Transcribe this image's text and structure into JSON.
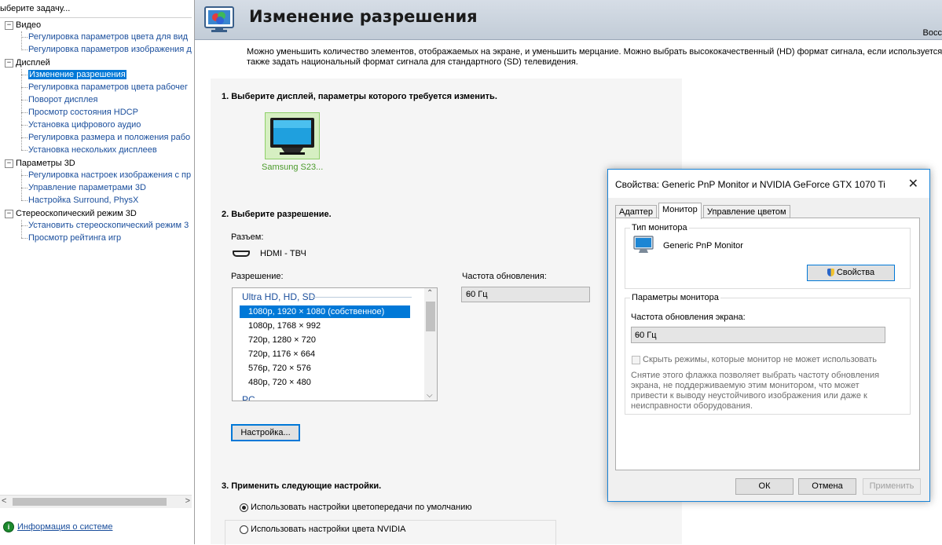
{
  "left_panel": {
    "title": "ыберите задачу...",
    "tree": [
      {
        "label": "Видео",
        "items": [
          "Регулировка параметров цвета для вид",
          "Регулировка параметров изображения д"
        ]
      },
      {
        "label": "Дисплей",
        "items": [
          "Изменение разрешения",
          "Регулировка параметров цвета рабочег",
          "Поворот дисплея",
          "Просмотр состояния HDCP",
          "Установка цифрового аудио",
          "Регулировка размера и положения рабо",
          "Установка нескольких дисплеев"
        ]
      },
      {
        "label": "Параметры 3D",
        "items": [
          "Регулировка настроек изображения с пр",
          "Управление параметрами 3D",
          "Настройка Surround, PhysX"
        ]
      },
      {
        "label": "Стереоскопический режим 3D",
        "items": [
          "Установить стереоскопический режим 3",
          "Просмотр рейтинга игр"
        ]
      }
    ],
    "selected_item": "Изменение разрешения",
    "system_info_link": "Информация о системе",
    "expander_symbol": "−"
  },
  "header": {
    "title": "Изменение разрешения",
    "restore_text": "Восс"
  },
  "description": {
    "line1": "Можно уменьшить количество элементов, отображаемых на экране, и уменьшить мерцание. Можно выбрать высококачественный (HD) формат сигнала, если используется",
    "line2": "также задать национальный формат сигнала для стандартного (SD) телевидения."
  },
  "section1": {
    "title": "1. Выберите дисплей, параметры которого требуется изменить.",
    "display_label": "Samsung S23..."
  },
  "section2": {
    "title": "2. Выберите разрешение.",
    "connector_label": "Разъем:",
    "connector_value": "HDMI - ТВЧ",
    "resolution_label": "Разрешение:",
    "refresh_label": "Частота обновления:",
    "refresh_value": "60 Гц",
    "list_group": "Ultra HD, HD, SD",
    "resolutions": [
      "1080p, 1920 × 1080 (собственное)",
      "1080p, 1768 × 992",
      "720p, 1280 × 720",
      "720p, 1176 × 664",
      "576p, 720 × 576",
      "480p, 720 × 480"
    ],
    "selected_resolution_index": 0,
    "list_group_pc": "PC",
    "setup_button": "Настройка..."
  },
  "section3": {
    "title": "3. Применить следующие настройки.",
    "radio_default": "Использовать настройки цветопередачи по умолчанию",
    "radio_nvidia": "Использовать настройки цвета NVIDIA",
    "selected_radio": "default"
  },
  "dialog": {
    "title": "Свойства: Generic PnP Monitor и NVIDIA GeForce GTX 1070 Ti",
    "close_symbol": "✕",
    "tabs": [
      "Адаптер",
      "Монитор",
      "Управление цветом"
    ],
    "active_tab": "Монитор",
    "monitor_type_group": "Тип монитора",
    "monitor_name": "Generic PnP Monitor",
    "properties_button": "Свойства",
    "monitor_params_group": "Параметры монитора",
    "refresh_rate_label": "Частота обновления экрана:",
    "refresh_rate_value": "60 Гц",
    "hide_modes_label": "Скрыть режимы, которые монитор не может использовать",
    "hide_modes_checked": false,
    "hint": "Снятие этого флажка позволяет выбрать частоту обновления экрана, не поддерживаемую этим монитором, что может привести к выводу неустойчивого изображения или даже к неисправности оборудования.",
    "ok_button": "ОК",
    "cancel_button": "Отмена",
    "apply_button": "Применить"
  },
  "colors": {
    "accent": "#0078d7",
    "link": "#1a4e9c",
    "display_selected_bg": "#d6efc2",
    "display_label": "#4b9b2b"
  },
  "icons": {
    "chevron_down": "⌵",
    "arrow_up": "⌃",
    "arrow_left": "<",
    "arrow_right": ">"
  }
}
